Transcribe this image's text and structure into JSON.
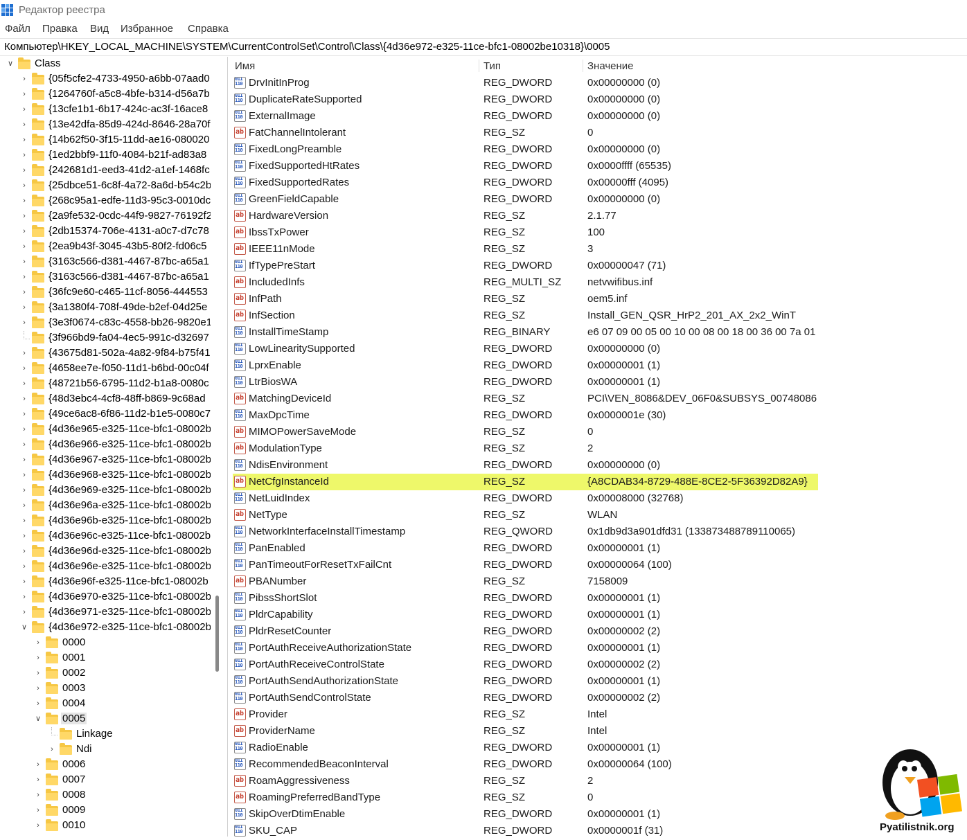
{
  "window": {
    "title": "Редактор реестра"
  },
  "menu": [
    "Файл",
    "Правка",
    "Вид",
    "Избранное",
    "Справка"
  ],
  "address": "Компьютер\\HKEY_LOCAL_MACHINE\\SYSTEM\\CurrentControlSet\\Control\\Class\\{4d36e972-e325-11ce-bfc1-08002be10318}\\0005",
  "tree": {
    "root": "Class",
    "items": [
      "{05f5cfe2-4733-4950-a6bb-07aad0",
      "{1264760f-a5c8-4bfe-b314-d56a7b",
      "{13cfe1b1-6b17-424c-ac3f-16ace8",
      "{13e42dfa-85d9-424d-8646-28a70f",
      "{14b62f50-3f15-11dd-ae16-080020",
      "{1ed2bbf9-11f0-4084-b21f-ad83a8",
      "{242681d1-eed3-41d2-a1ef-1468fc",
      "{25dbce51-6c8f-4a72-8a6d-b54c2b",
      "{268c95a1-edfe-11d3-95c3-0010dc",
      "{2a9fe532-0cdc-44f9-9827-76192f2",
      "{2db15374-706e-4131-a0c7-d7c78",
      "{2ea9b43f-3045-43b5-80f2-fd06c5",
      "{3163c566-d381-4467-87bc-a65a1",
      "{3163c566-d381-4467-87bc-a65a1",
      "{36fc9e60-c465-11cf-8056-444553",
      "{3a1380f4-708f-49de-b2ef-04d25e",
      "{3e3f0674-c83c-4558-bb26-9820e1",
      "{3f966bd9-fa04-4ec5-991c-d32697",
      "{43675d81-502a-4a82-9f84-b75f41",
      "{4658ee7e-f050-11d1-b6bd-00c04f",
      "{48721b56-6795-11d2-b1a8-0080c",
      "{48d3ebc4-4cf8-48ff-b869-9c68ad",
      "{49ce6ac8-6f86-11d2-b1e5-0080c7",
      "{4d36e965-e325-11ce-bfc1-08002b",
      "{4d36e966-e325-11ce-bfc1-08002b",
      "{4d36e967-e325-11ce-bfc1-08002b",
      "{4d36e968-e325-11ce-bfc1-08002b",
      "{4d36e969-e325-11ce-bfc1-08002b",
      "{4d36e96a-e325-11ce-bfc1-08002b",
      "{4d36e96b-e325-11ce-bfc1-08002b",
      "{4d36e96c-e325-11ce-bfc1-08002b",
      "{4d36e96d-e325-11ce-bfc1-08002b",
      "{4d36e96e-e325-11ce-bfc1-08002b",
      "{4d36e96f-e325-11ce-bfc1-08002b",
      "{4d36e970-e325-11ce-bfc1-08002b",
      "{4d36e971-e325-11ce-bfc1-08002b",
      "{4d36e972-e325-11ce-bfc1-08002b"
    ],
    "subkeys": [
      "0000",
      "0001",
      "0002",
      "0003",
      "0004",
      "0005",
      "0006",
      "0007",
      "0008",
      "0009",
      "0010"
    ],
    "selected_children": [
      "Linkage",
      "Ndi"
    ]
  },
  "columns": {
    "name": "Имя",
    "type": "Тип",
    "value": "Значение"
  },
  "values": [
    {
      "n": "DrvInitInProg",
      "t": "REG_DWORD",
      "v": "0x00000000 (0)"
    },
    {
      "n": "DuplicateRateSupported",
      "t": "REG_DWORD",
      "v": "0x00000000 (0)"
    },
    {
      "n": "ExternalImage",
      "t": "REG_DWORD",
      "v": "0x00000000 (0)"
    },
    {
      "n": "FatChannelIntolerant",
      "t": "REG_SZ",
      "v": "0"
    },
    {
      "n": "FixedLongPreamble",
      "t": "REG_DWORD",
      "v": "0x00000000 (0)"
    },
    {
      "n": "FixedSupportedHtRates",
      "t": "REG_DWORD",
      "v": "0x0000ffff (65535)"
    },
    {
      "n": "FixedSupportedRates",
      "t": "REG_DWORD",
      "v": "0x00000fff (4095)"
    },
    {
      "n": "GreenFieldCapable",
      "t": "REG_DWORD",
      "v": "0x00000000 (0)"
    },
    {
      "n": "HardwareVersion",
      "t": "REG_SZ",
      "v": "2.1.77"
    },
    {
      "n": "IbssTxPower",
      "t": "REG_SZ",
      "v": "100"
    },
    {
      "n": "IEEE11nMode",
      "t": "REG_SZ",
      "v": "3"
    },
    {
      "n": "IfTypePreStart",
      "t": "REG_DWORD",
      "v": "0x00000047 (71)"
    },
    {
      "n": "IncludedInfs",
      "t": "REG_MULTI_SZ",
      "v": "netvwifibus.inf"
    },
    {
      "n": "InfPath",
      "t": "REG_SZ",
      "v": "oem5.inf"
    },
    {
      "n": "InfSection",
      "t": "REG_SZ",
      "v": "Install_GEN_QSR_HrP2_201_AX_2x2_WinT"
    },
    {
      "n": "InstallTimeStamp",
      "t": "REG_BINARY",
      "v": "e6 07 09 00 05 00 10 00 08 00 18 00 36 00 7a 01"
    },
    {
      "n": "LowLinearitySupported",
      "t": "REG_DWORD",
      "v": "0x00000000 (0)"
    },
    {
      "n": "LprxEnable",
      "t": "REG_DWORD",
      "v": "0x00000001 (1)"
    },
    {
      "n": "LtrBiosWA",
      "t": "REG_DWORD",
      "v": "0x00000001 (1)"
    },
    {
      "n": "MatchingDeviceId",
      "t": "REG_SZ",
      "v": "PCI\\VEN_8086&DEV_06F0&SUBSYS_00748086"
    },
    {
      "n": "MaxDpcTime",
      "t": "REG_DWORD",
      "v": "0x0000001e (30)"
    },
    {
      "n": "MIMOPowerSaveMode",
      "t": "REG_SZ",
      "v": "0"
    },
    {
      "n": "ModulationType",
      "t": "REG_SZ",
      "v": "2"
    },
    {
      "n": "NdisEnvironment",
      "t": "REG_DWORD",
      "v": "0x00000000 (0)"
    },
    {
      "n": "NetCfgInstanceId",
      "t": "REG_SZ",
      "v": "{A8CDAB34-8729-488E-8CE2-5F36392D82A9}"
    },
    {
      "n": "NetLuidIndex",
      "t": "REG_DWORD",
      "v": "0x00008000 (32768)"
    },
    {
      "n": "NetType",
      "t": "REG_SZ",
      "v": "WLAN"
    },
    {
      "n": "NetworkInterfaceInstallTimestamp",
      "t": "REG_QWORD",
      "v": "0x1db9d3a901dfd31 (133873488789110065)"
    },
    {
      "n": "PanEnabled",
      "t": "REG_DWORD",
      "v": "0x00000001 (1)"
    },
    {
      "n": "PanTimeoutForResetTxFailCnt",
      "t": "REG_DWORD",
      "v": "0x00000064 (100)"
    },
    {
      "n": "PBANumber",
      "t": "REG_SZ",
      "v": "7158009"
    },
    {
      "n": "PibssShortSlot",
      "t": "REG_DWORD",
      "v": "0x00000001 (1)"
    },
    {
      "n": "PldrCapability",
      "t": "REG_DWORD",
      "v": "0x00000001 (1)"
    },
    {
      "n": "PldrResetCounter",
      "t": "REG_DWORD",
      "v": "0x00000002 (2)"
    },
    {
      "n": "PortAuthReceiveAuthorizationState",
      "t": "REG_DWORD",
      "v": "0x00000001 (1)"
    },
    {
      "n": "PortAuthReceiveControlState",
      "t": "REG_DWORD",
      "v": "0x00000002 (2)"
    },
    {
      "n": "PortAuthSendAuthorizationState",
      "t": "REG_DWORD",
      "v": "0x00000001 (1)"
    },
    {
      "n": "PortAuthSendControlState",
      "t": "REG_DWORD",
      "v": "0x00000002 (2)"
    },
    {
      "n": "Provider",
      "t": "REG_SZ",
      "v": "Intel"
    },
    {
      "n": "ProviderName",
      "t": "REG_SZ",
      "v": "Intel"
    },
    {
      "n": "RadioEnable",
      "t": "REG_DWORD",
      "v": "0x00000001 (1)"
    },
    {
      "n": "RecommendedBeaconInterval",
      "t": "REG_DWORD",
      "v": "0x00000064 (100)"
    },
    {
      "n": "RoamAggressiveness",
      "t": "REG_SZ",
      "v": "2"
    },
    {
      "n": "RoamingPreferredBandType",
      "t": "REG_SZ",
      "v": "0"
    },
    {
      "n": "SkipOverDtimEnable",
      "t": "REG_DWORD",
      "v": "0x00000001 (1)"
    },
    {
      "n": "SKU_CAP",
      "t": "REG_DWORD",
      "v": "0x0000001f (31)"
    }
  ],
  "highlight_row": "NetCfgInstanceId",
  "highlight_color": "#eef86a",
  "watermark": "Pyatilistnik.org"
}
